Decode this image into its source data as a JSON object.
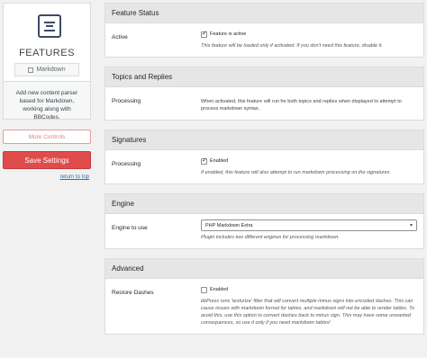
{
  "sidebar": {
    "feature_title": "FEATURES",
    "feature_tag": "Markdown",
    "description": "Add new content parser based for Markdown, working along with BBCodes.",
    "more_controls": "More Controls",
    "save_settings": "Save Settings",
    "return_to_top": "return to top"
  },
  "sections": {
    "status": {
      "header": "Feature Status",
      "label": "Active",
      "checkbox_label": "Feature is active",
      "checked": true,
      "desc": "This feature will be loaded only if activated. If you don't need this feature, disable it."
    },
    "topics": {
      "header": "Topics and Replies",
      "label": "Processing",
      "text": "When activated, this feature will run for both topics and replies when displayed to attempt to process markdown syntax."
    },
    "signatures": {
      "header": "Signatures",
      "label": "Processing",
      "checkbox_label": "Enabled",
      "checked": true,
      "desc": "If enabled, this feature will also attempt to run markdown processing on the signatures."
    },
    "engine": {
      "header": "Engine",
      "label": "Engine to use",
      "selected": "PHP Markdown Extra",
      "desc": "Plugin includes two different engines for processing markdown."
    },
    "advanced": {
      "header": "Advanced",
      "label": "Restore Dashes",
      "checkbox_label": "Enabled",
      "checked": false,
      "desc": "bbPress runs 'texturize' filter that will convert multiple minus signs into encoded dashes. This can cause issues with markdown format for tables, and markdown will not be able to render tables. To avoid this, use this option to convert dashes back to minus sign. This may have some unwanted consequences, so use it only if you need markdown tables!"
    }
  }
}
